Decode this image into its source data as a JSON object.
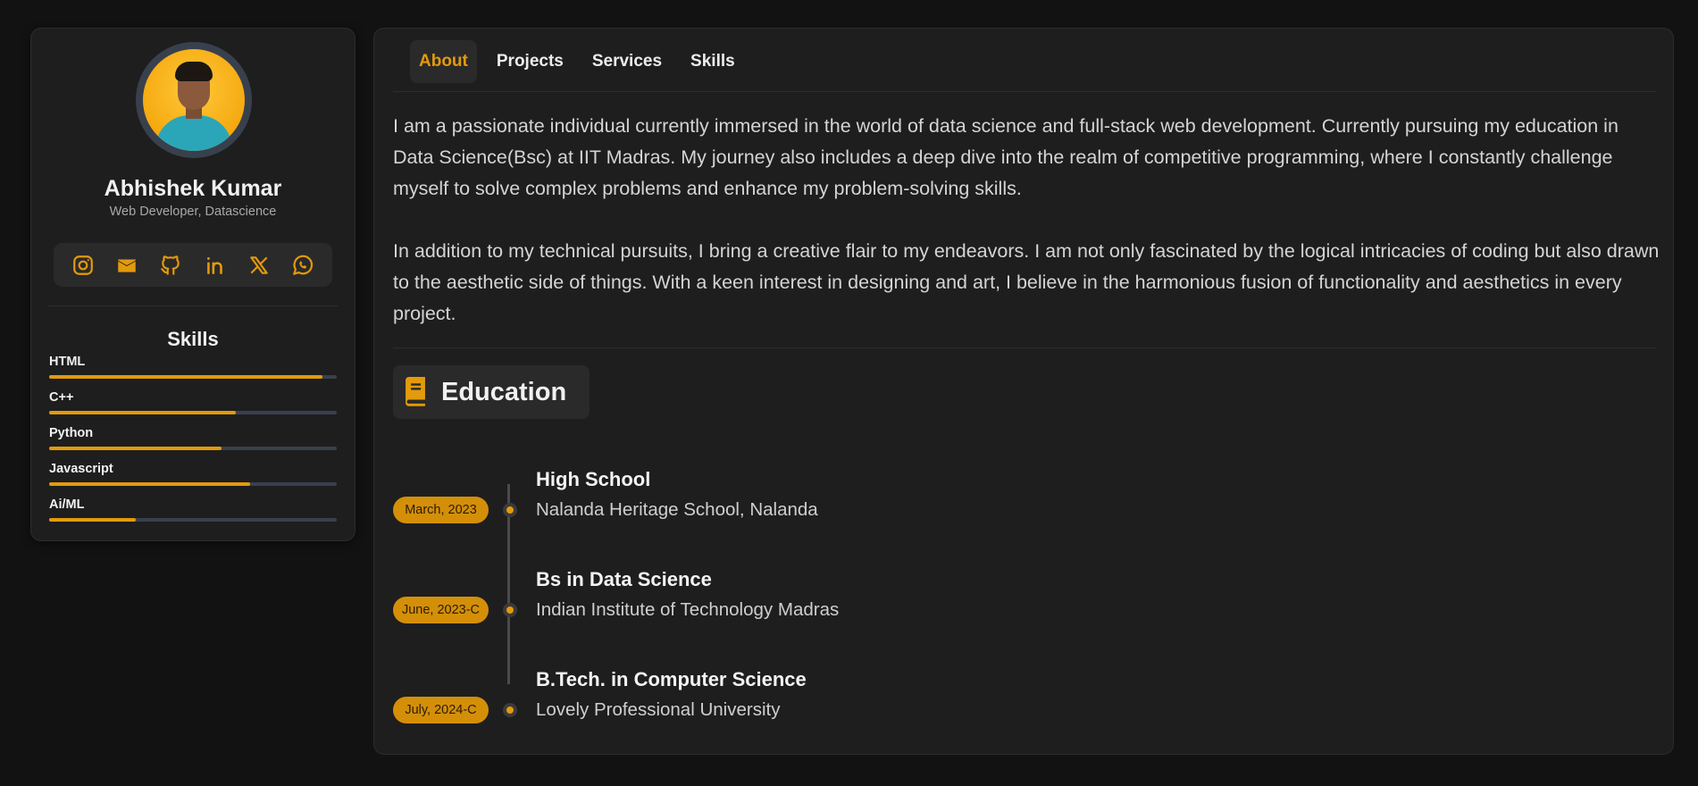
{
  "profile": {
    "name": "Abhishek Kumar",
    "role": "Web Developer, Datascience",
    "accent": "#e39a0b",
    "social": [
      {
        "icon": "instagram-icon"
      },
      {
        "icon": "mail-icon"
      },
      {
        "icon": "github-icon"
      },
      {
        "icon": "linkedin-icon"
      },
      {
        "icon": "x-icon"
      },
      {
        "icon": "whatsapp-icon"
      }
    ]
  },
  "skills": {
    "title": "Skills",
    "items": [
      {
        "label": "HTML",
        "level": 0.95
      },
      {
        "label": "C++",
        "level": 0.65
      },
      {
        "label": "Python",
        "level": 0.6
      },
      {
        "label": "Javascript",
        "level": 0.7
      },
      {
        "label": "Ai/ML",
        "level": 0.3
      }
    ]
  },
  "nav": {
    "tabs": [
      {
        "label": "About",
        "active": true
      },
      {
        "label": "Projects",
        "active": false
      },
      {
        "label": "Services",
        "active": false
      },
      {
        "label": "Skills",
        "active": false
      }
    ]
  },
  "about": {
    "paragraphs": [
      "I am a passionate individual currently immersed in the world of data science and full-stack web development. Currently pursuing my education in Data Science(Bsc) at IIT Madras. My journey also includes a deep dive into the realm of competitive programming, where I constantly challenge myself to solve complex problems and enhance my problem-solving skills.",
      "In addition to my technical pursuits, I bring a creative flair to my endeavors. I am not only fascinated by the logical intricacies of coding but also drawn to the aesthetic side of things. With a keen interest in designing and art, I believe in the harmonious fusion of functionality and aesthetics in every project."
    ]
  },
  "education": {
    "title": "Education",
    "icon": "book-icon",
    "items": [
      {
        "date": "March, 2023",
        "title": "High School",
        "institution": "Nalanda Heritage School, Nalanda"
      },
      {
        "date": "June, 2023-C",
        "title": "Bs in Data Science",
        "institution": "Indian Institute of Technology Madras"
      },
      {
        "date": "July, 2024-C",
        "title": "B.Tech. in Computer Science",
        "institution": "Lovely Professional University"
      }
    ]
  }
}
